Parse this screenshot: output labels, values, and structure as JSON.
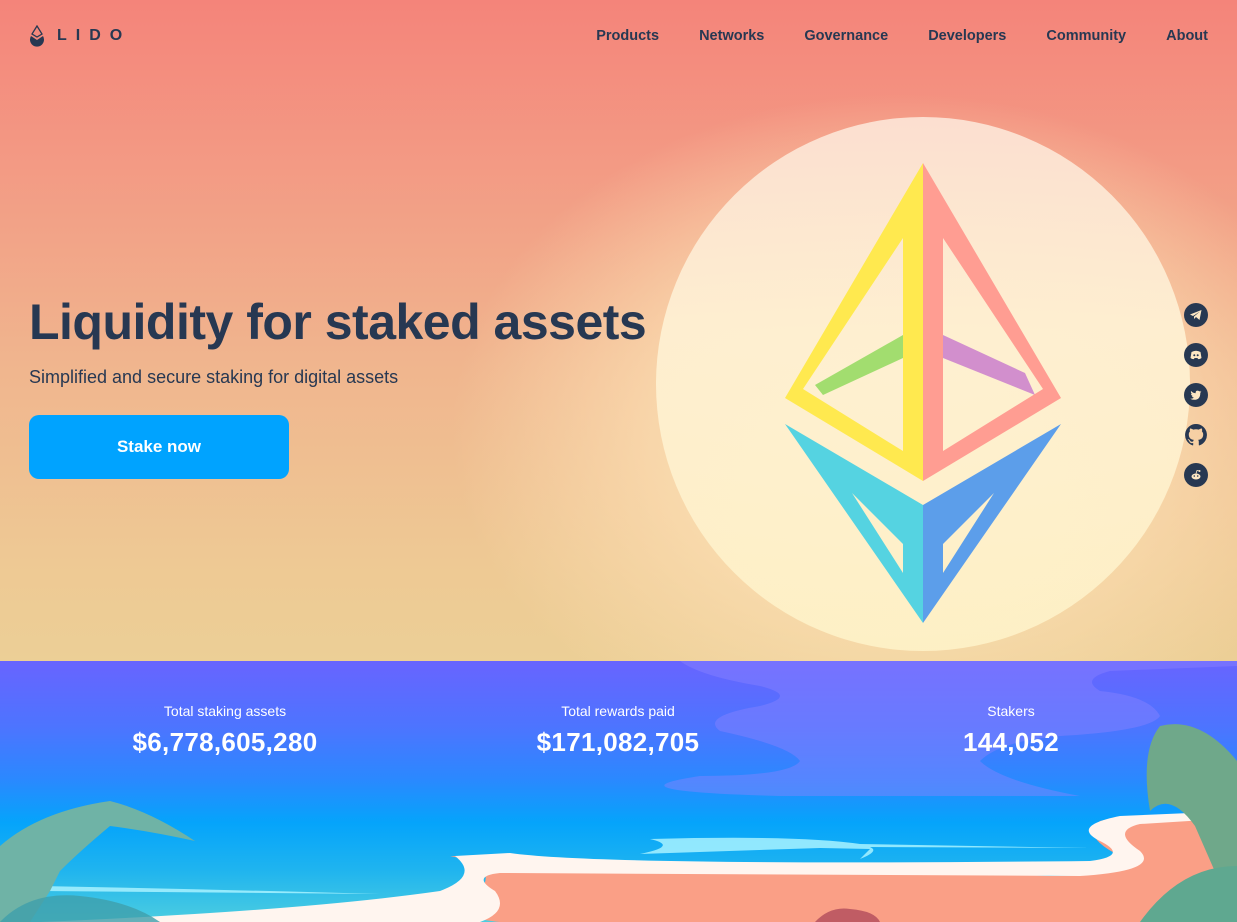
{
  "header": {
    "logo_text": "LIDO",
    "nav": [
      {
        "label": "Products"
      },
      {
        "label": "Networks"
      },
      {
        "label": "Governance"
      },
      {
        "label": "Developers"
      },
      {
        "label": "Community"
      },
      {
        "label": "About"
      }
    ]
  },
  "hero": {
    "title": "Liquidity for staked assets",
    "subtitle": "Simplified and secure staking for digital assets",
    "cta_label": "Stake now"
  },
  "social": [
    {
      "name": "telegram-icon"
    },
    {
      "name": "discord-icon"
    },
    {
      "name": "twitter-icon"
    },
    {
      "name": "github-icon"
    },
    {
      "name": "reddit-icon"
    }
  ],
  "stats": [
    {
      "label": "Total staking assets",
      "value": "$6,778,605,280"
    },
    {
      "label": "Total rewards paid",
      "value": "$171,082,705"
    },
    {
      "label": "Stakers",
      "value": "144,052"
    }
  ],
  "colors": {
    "primary_text": "#273852",
    "cta": "#00a3ff",
    "eth_yellow": "#ffe94f",
    "eth_pink": "#ff9d92",
    "eth_green": "#a2dd6f",
    "eth_purple": "#d28fcd",
    "eth_cyan": "#55d3e1",
    "eth_blue": "#5c9eea"
  }
}
